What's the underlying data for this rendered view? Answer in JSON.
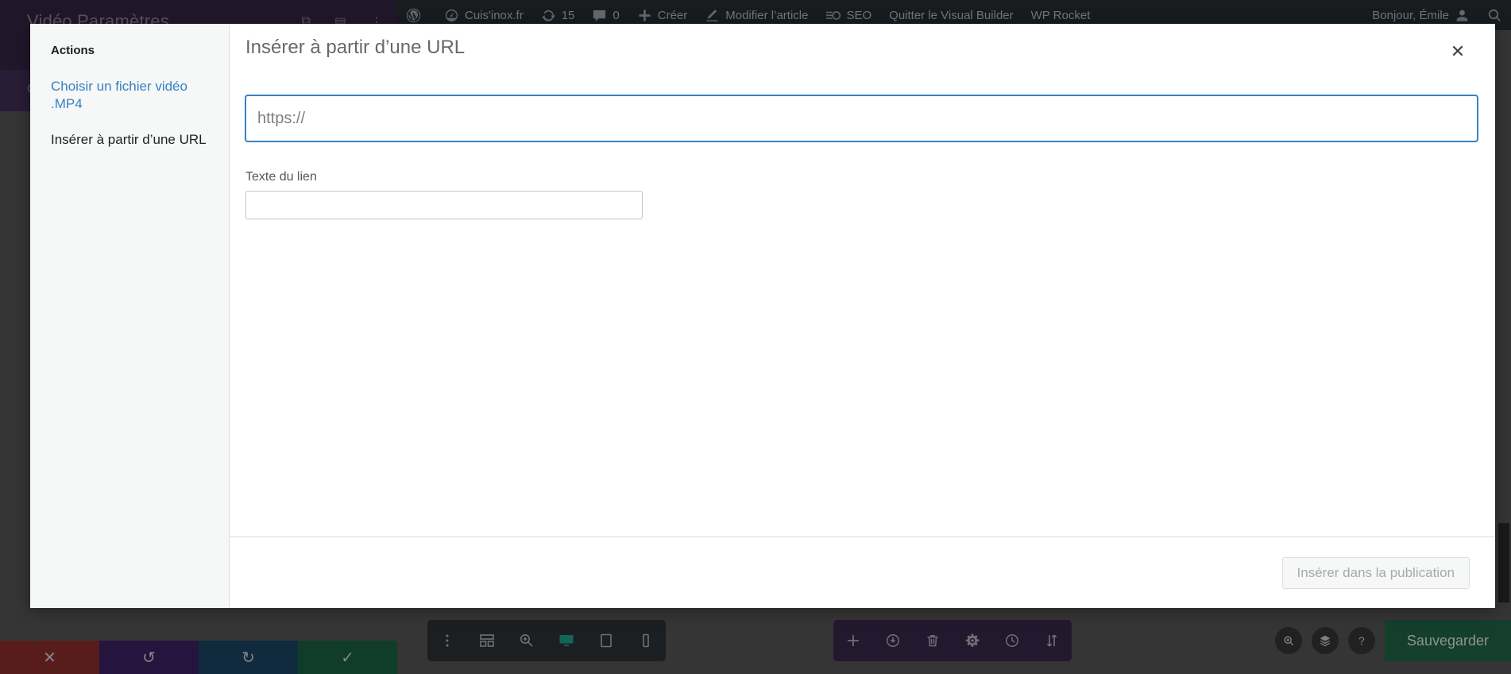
{
  "background": {
    "divi_panel": {
      "title": "Vidéo Paramètres",
      "icons": [
        "duplicate-icon",
        "layout-icon",
        "more-vertical-icon"
      ],
      "row2_label": "C"
    }
  },
  "adminbar": {
    "items": [
      {
        "name": "wordpress-logo",
        "icon": "wordpress-icon",
        "label": ""
      },
      {
        "name": "site-name",
        "icon": "dashboard-icon",
        "label": "Cuis'inox.fr"
      },
      {
        "name": "updates",
        "icon": "update-icon",
        "label": "15"
      },
      {
        "name": "comments",
        "icon": "comment-icon",
        "label": "0"
      },
      {
        "name": "new-content",
        "icon": "plus-icon",
        "label": "Créer"
      },
      {
        "name": "edit-post",
        "icon": "pencil-icon",
        "label": "Modifier l’article"
      },
      {
        "name": "seo",
        "icon": "seo-icon",
        "label": "SEO"
      },
      {
        "name": "exit-visual-builder",
        "icon": "",
        "label": "Quitter le Visual Builder"
      },
      {
        "name": "wp-rocket",
        "icon": "",
        "label": "WP Rocket"
      }
    ],
    "greeting": "Bonjour, Émile",
    "avatar_icon": "user-avatar-icon",
    "search_icon": "search-icon"
  },
  "modal": {
    "title": "Insérer à partir d’une URL",
    "close_label": "✕",
    "sidebar": {
      "heading": "Actions",
      "items": [
        {
          "label": "Choisir un fichier vidéo .MP4",
          "active": false
        },
        {
          "label": "Insérer à partir d’une URL",
          "active": true
        }
      ]
    },
    "url_field": {
      "value": "",
      "placeholder": "https://"
    },
    "link_text_field": {
      "label": "Texte du lien",
      "value": "",
      "placeholder": ""
    },
    "footer": {
      "insert_button": "Insérer dans la publication"
    }
  },
  "bottom_bars": {
    "color_buttons": [
      {
        "name": "cancel-button",
        "icon": "close-icon",
        "glyph": "✕",
        "color": "#8c2424"
      },
      {
        "name": "undo-button",
        "icon": "undo-icon",
        "glyph": "↺",
        "color": "#32165c"
      },
      {
        "name": "redo-button",
        "icon": "redo-icon",
        "glyph": "↻",
        "color": "#0d3d5c"
      },
      {
        "name": "confirm-button",
        "icon": "check-icon",
        "glyph": "✓",
        "color": "#0f5c3d"
      }
    ],
    "left_toolbar": [
      "more-vertical-icon",
      "wireframe-icon",
      "zoom-icon",
      "desktop-icon",
      "tablet-icon",
      "mobile-icon"
    ],
    "left_toolbar_active": "desktop-icon",
    "mid_toolbar": [
      "plus-icon",
      "save-library-icon",
      "trash-icon",
      "settings-gear-icon",
      "history-clock-icon",
      "sort-icon"
    ],
    "right_round_buttons": [
      "search-icon",
      "layers-icon",
      "help-icon"
    ],
    "save_button": "Sauvegarder"
  },
  "colors": {
    "accent_blue": "#3582c4",
    "save_green": "#13603f",
    "divi_purple": "#2f1c42",
    "adminbar_dark": "#1d2327"
  }
}
